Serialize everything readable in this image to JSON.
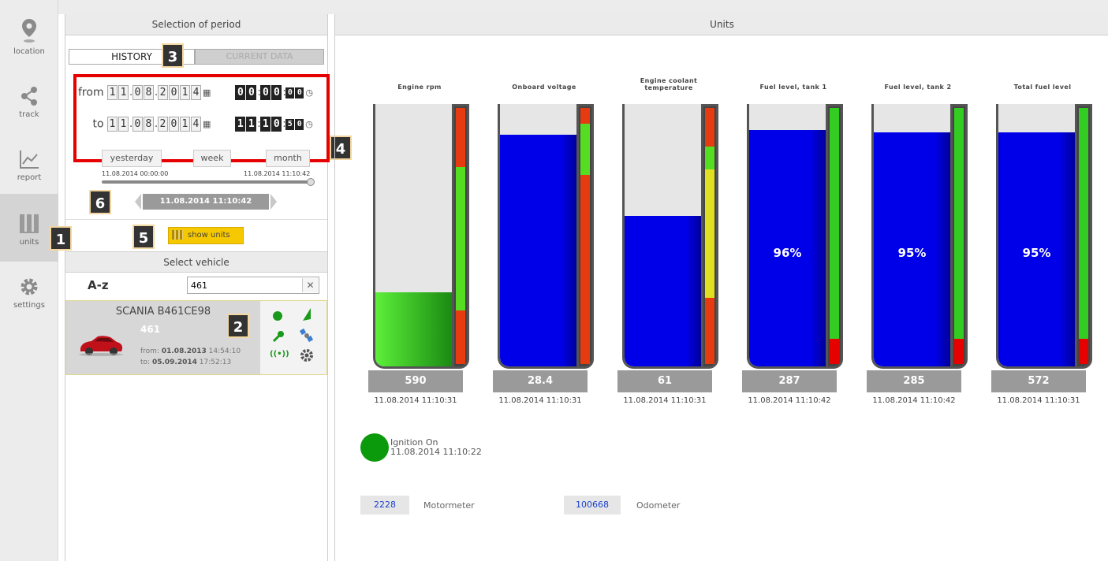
{
  "nav": {
    "items": [
      {
        "label": "location",
        "icon": "map-pin-icon"
      },
      {
        "label": "track",
        "icon": "share-nodes-icon"
      },
      {
        "label": "report",
        "icon": "line-chart-icon"
      },
      {
        "label": "units",
        "icon": "bars-icon"
      },
      {
        "label": "settings",
        "icon": "gear-icon"
      }
    ],
    "active": "units"
  },
  "period": {
    "header": "Selection of period",
    "tab_history": "HISTORY",
    "tab_current": "CURRENT DATA",
    "from_label": "from",
    "to_label": "to",
    "from_date": [
      "1",
      "1",
      ".",
      "0",
      "8",
      ".",
      "2",
      "0",
      "1",
      "4"
    ],
    "from_time": [
      "0",
      "0",
      ":",
      "0",
      "0",
      ":",
      "0",
      "0"
    ],
    "to_date": [
      "1",
      "1",
      ".",
      "0",
      "8",
      ".",
      "2",
      "0",
      "1",
      "4"
    ],
    "to_time": [
      "1",
      "1",
      ":",
      "1",
      "0",
      ":",
      "5",
      "0"
    ],
    "btn_yesterday": "yesterday",
    "btn_week": "week",
    "btn_month": "month",
    "slider_start": "11.08.2014 00:00:00",
    "slider_end": "11.08.2014 11:10:42",
    "slider_current": "11.08.2014 11:10:42",
    "show_units": "show units"
  },
  "vehicle": {
    "header": "Select vehicle",
    "sort_label": "A-z",
    "search_value": "461",
    "name": "SCANIA B461CE98",
    "id": "461",
    "from_label": "from:",
    "from_value": "01.08.2013",
    "from_time": "14:54:10",
    "to_label": "to:",
    "to_value": "05.09.2014",
    "to_time": "17:52:13"
  },
  "badges": [
    "1",
    "2",
    "3",
    "4",
    "5",
    "6"
  ],
  "units": {
    "header": "Units",
    "gauges": [
      {
        "title": "Engine rpm",
        "value": "590",
        "time": "11.08.2014 11:10:31",
        "fill": 0.3,
        "fill_color": "green",
        "pct": "",
        "segments": [
          [
            "#e63a10",
            0.23
          ],
          [
            "#55dd22",
            0.56
          ],
          [
            "#e63a10",
            0.21
          ]
        ]
      },
      {
        "title": "Onboard voltage",
        "value": "28.4",
        "time": "11.08.2014 11:10:31",
        "fill": 0.94,
        "fill_color": "blue",
        "pct": "",
        "segments": [
          [
            "#e63a10",
            0.06
          ],
          [
            "#55dd22",
            0.2
          ],
          [
            "#e63a10",
            0.74
          ]
        ]
      },
      {
        "title": "Engine coolant temperature",
        "value": "61",
        "time": "11.08.2014 11:10:31",
        "fill": 0.61,
        "fill_color": "blue",
        "pct": "",
        "segments": [
          [
            "#e63a10",
            0.15
          ],
          [
            "#55dd22",
            0.09
          ],
          [
            "#e0e020",
            0.5
          ],
          [
            "#e63a10",
            0.26
          ]
        ]
      },
      {
        "title": "Fuel level, tank 1",
        "value": "287",
        "time": "11.08.2014 11:10:42",
        "fill": 0.96,
        "fill_color": "blue",
        "pct": "96%",
        "segments": [
          [
            "#33cc22",
            0.9
          ],
          [
            "#e60000",
            0.1
          ]
        ]
      },
      {
        "title": "Fuel level, tank 2",
        "value": "285",
        "time": "11.08.2014 11:10:42",
        "fill": 0.95,
        "fill_color": "blue",
        "pct": "95%",
        "segments": [
          [
            "#33cc22",
            0.9
          ],
          [
            "#e60000",
            0.1
          ]
        ]
      },
      {
        "title": "Total fuel level",
        "value": "572",
        "time": "11.08.2014 11:10:31",
        "fill": 0.95,
        "fill_color": "blue",
        "pct": "95%",
        "segments": [
          [
            "#33cc22",
            0.9
          ],
          [
            "#e60000",
            0.1
          ]
        ]
      }
    ],
    "ignition_label": "Ignition On",
    "ignition_time": "11.08.2014 11:10:22",
    "motormeter_value": "2228",
    "motormeter_label": "Motormeter",
    "odometer_value": "100668",
    "odometer_label": "Odometer"
  },
  "colors": {
    "accent": "#f5c800",
    "blue": "#0000dd",
    "green": "#3bd63b",
    "red_frame": "#e60000"
  }
}
